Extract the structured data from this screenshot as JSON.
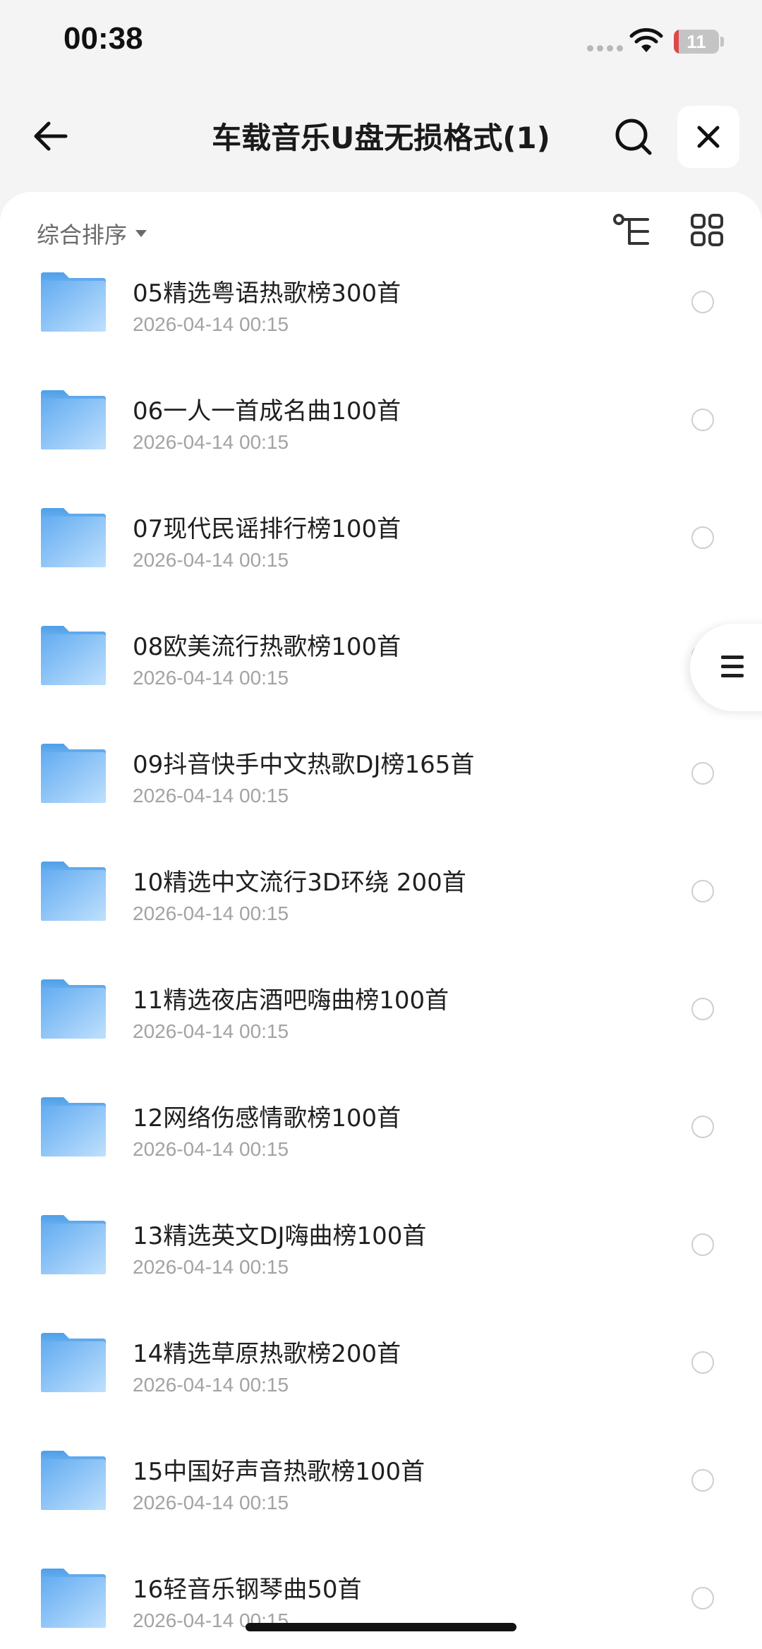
{
  "status_bar": {
    "time": "00:38",
    "battery": "11",
    "icons": [
      "signal-dots-icon",
      "wifi-icon",
      "battery-icon"
    ]
  },
  "nav": {
    "title": "车载音乐U盘无损格式(1)",
    "icons": [
      "back-arrow-icon",
      "search-icon",
      "close-icon"
    ]
  },
  "toolbar": {
    "sort_label": "综合排序",
    "icons": [
      "sort-caret-icon",
      "tree-view-icon",
      "grid-view-icon"
    ]
  },
  "files": [
    {
      "name": "05精选粤语热歌榜300首",
      "date": "2026-04-14 00:15"
    },
    {
      "name": "06一人一首成名曲100首",
      "date": "2026-04-14 00:15"
    },
    {
      "name": "07现代民谣排行榜100首",
      "date": "2026-04-14 00:15"
    },
    {
      "name": "08欧美流行热歌榜100首",
      "date": "2026-04-14 00:15"
    },
    {
      "name": "09抖音快手中文热歌DJ榜165首",
      "date": "2026-04-14 00:15"
    },
    {
      "name": "10精选中文流行3D环绕 200首",
      "date": "2026-04-14 00:15"
    },
    {
      "name": "11精选夜店酒吧嗨曲榜100首",
      "date": "2026-04-14 00:15"
    },
    {
      "name": "12网络伤感情歌榜100首",
      "date": "2026-04-14 00:15"
    },
    {
      "name": "13精选英文DJ嗨曲榜100首",
      "date": "2026-04-14 00:15"
    },
    {
      "name": "14精选草原热歌榜200首",
      "date": "2026-04-14 00:15"
    },
    {
      "name": "15中国好声音热歌榜100首",
      "date": "2026-04-14 00:15"
    },
    {
      "name": "16轻音乐钢琴曲50首",
      "date": "2026-04-14 00:15"
    }
  ],
  "colors": {
    "folder_light": "#a9d4fb",
    "folder_dark": "#5aa8f0",
    "battery_low": "#e04848"
  }
}
